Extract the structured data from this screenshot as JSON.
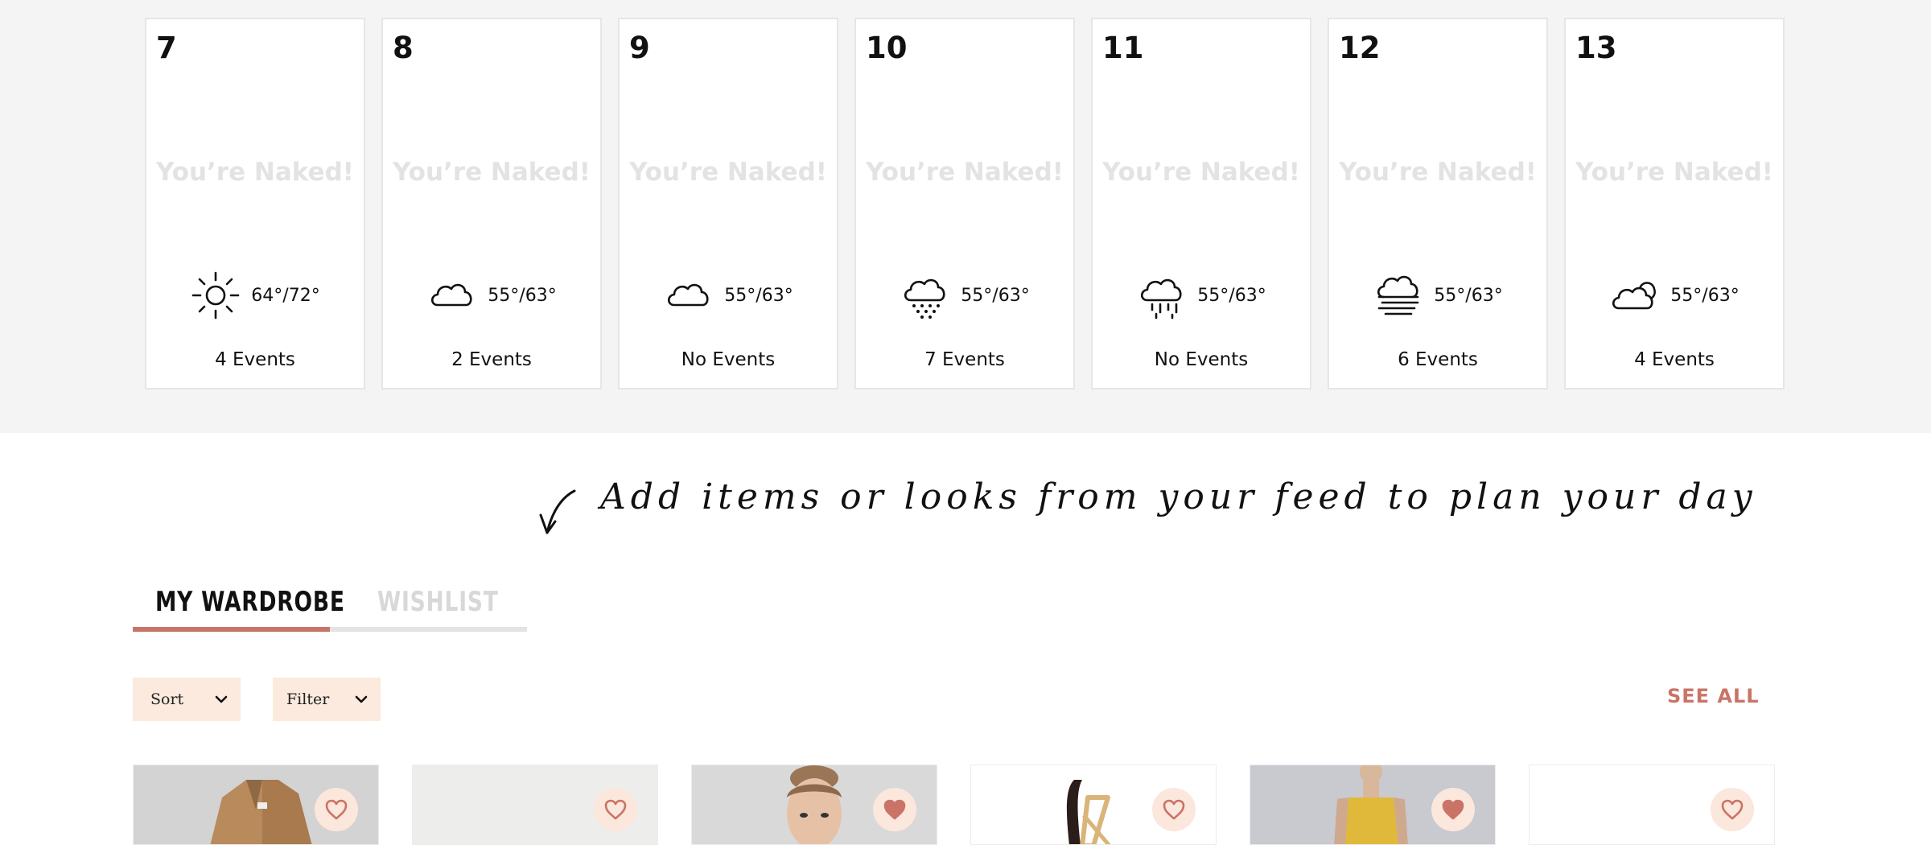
{
  "calendar": {
    "days": [
      {
        "date": "7",
        "placeholder": "You’re Naked!",
        "weather_icon": "sun-icon",
        "temp": "64°/72°",
        "events": "4 Events"
      },
      {
        "date": "8",
        "placeholder": "You’re Naked!",
        "weather_icon": "cloud-icon",
        "temp": "55°/63°",
        "events": "2 Events"
      },
      {
        "date": "9",
        "placeholder": "You’re Naked!",
        "weather_icon": "cloud-icon",
        "temp": "55°/63°",
        "events": "No Events"
      },
      {
        "date": "10",
        "placeholder": "You’re Naked!",
        "weather_icon": "snow-cloud-icon",
        "temp": "55°/63°",
        "events": "7 Events"
      },
      {
        "date": "11",
        "placeholder": "You’re Naked!",
        "weather_icon": "rain-cloud-icon",
        "temp": "55°/63°",
        "events": "No Events"
      },
      {
        "date": "12",
        "placeholder": "You’re Naked!",
        "weather_icon": "fog-cloud-icon",
        "temp": "55°/63°",
        "events": "6 Events"
      },
      {
        "date": "13",
        "placeholder": "You’re Naked!",
        "weather_icon": "partly-cloudy-icon",
        "temp": "55°/63°",
        "events": "4 Events"
      }
    ]
  },
  "hint": {
    "text": "Add items or looks from your feed to plan your day",
    "icon": "curved-arrow-icon"
  },
  "tabs": {
    "wardrobe": "MY WARDROBE",
    "wishlist": "WISHLIST",
    "active": "wardrobe"
  },
  "controls": {
    "sort_label": "Sort",
    "filter_label": "Filter",
    "see_all": "SEE ALL"
  },
  "items": [
    {
      "name": "camel-coat",
      "favorited": false,
      "tint": "#cfcfcf"
    },
    {
      "name": "item-2",
      "favorited": false,
      "tint": "#ececec"
    },
    {
      "name": "woman-portrait",
      "favorited": true,
      "tint": "#d6d6d6"
    },
    {
      "name": "belt",
      "favorited": false,
      "tint": "#ffffff"
    },
    {
      "name": "yellow-dress",
      "favorited": true,
      "tint": "#c8c8cf"
    },
    {
      "name": "item-6",
      "favorited": false,
      "tint": "#ffffff"
    }
  ],
  "colors": {
    "accent": "#c97467",
    "heart_bg": "#fbe7dc",
    "dropdown_bg": "#fbeadd",
    "band_bg": "#f4f4f4"
  }
}
